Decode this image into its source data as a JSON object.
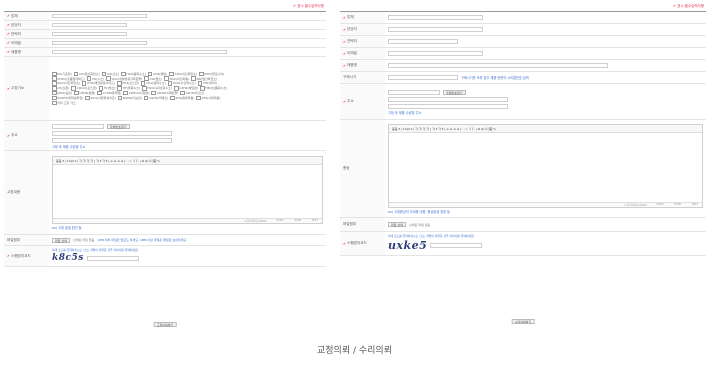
{
  "left": {
    "required_note": "✔ 표시 필수입력사항",
    "labels": {
      "company": "업체",
      "manager": "담당자",
      "phone": "연락처",
      "email": "이메일",
      "product": "제품명",
      "symptom": "고장기소",
      "address": "주소",
      "details": "고장내용",
      "attachment": "파일첨부",
      "captcha": "스팸방지코드"
    },
    "symptom_options": [
      [
        "EK(기준판)",
        "CO(일산화탄소)",
        "O2(산소)",
        "H2S(황화수소)",
        "CH4(메탄)",
        "CO2(이산화탄소)",
        "NH3(암모니아)"
      ],
      [
        "CH2O(포름알데히드)",
        "H2(수소)",
        "VOC(휘발성유기화합물)",
        "Cl2(염소)",
        "SO2(이산화황)",
        "NO(일산화질소)"
      ],
      [
        "NO2(이산화질소)",
        "ETO(에틸렌옥사이드)",
        "PH3(포스핀)",
        "HCL(염화수소)",
        "HCN(시안화수소)",
        "THT(퍼치)"
      ],
      [
        "O3(오존)",
        "COCl2(포스겐)",
        "F2(불소)",
        "HF(불화수소)",
        "H2O2(과산화수소)",
        "C2H4(에틸렌)",
        "HBr(브롬화수소)"
      ],
      [
        "SiH4(실란)",
        "C6H6(벤젠)",
        "C7H8(톨루엔)",
        "C8H10(자일렌)",
        "CH3OH(메탄올)",
        "AsH3(아르신)"
      ],
      [
        "SO2F2(불화설퍼릴)",
        "SiF4(사불화실리콘)",
        "B2H6(디보란)",
        "GeH4(저메인)",
        "SF6(육불화황)",
        "SF4(사불화황)"
      ],
      [
        "기타 고장 가스"
      ]
    ],
    "zip_button": "우편번호찾기",
    "address_note": "고정 후 제품 수령할 주소",
    "editor_toolbar": "돋움 ▾ | 12pt ▾ | 가 가 가 가 | 가 ▾ 가 ▾ | ≡ ≡ ≡ ≡ | ⁝ ⁝ | 《 》 | Ω ⊞ ☺ 🖼 ✎",
    "editor_counter": "0 입력/최대 20000",
    "editor_modes": [
      "Editor",
      "HTML",
      "TEXT"
    ],
    "details_note": "ex) 고장 발생 원인 등",
    "file_button": "파일 선택",
    "file_status": "선택된 파일 없음",
    "file_note": "1MB 이하 파일만 업로드 하세요. 1MB 이상 파일은 메일로 보내주세요.",
    "captcha_note": "아래 코드를 입력하십시오 (코드 식별이 어려운 경우 이미지를 클릭하세요)",
    "captcha_text": "k8c5s",
    "submit": "고정의뢰하기"
  },
  "right": {
    "required_note": "✔ 표시 필수입력사항",
    "labels": {
      "company": "업체",
      "manager": "담당자",
      "phone": "연락처",
      "email": "이메일",
      "product": "제품명",
      "purchase": "구매시기",
      "address": "주소",
      "symptom": "증상",
      "attachment": "파일첨부",
      "captcha": "스팸방지코드"
    },
    "purchase_note": "구매시기를 모를 경우 제품 뒷면의 시리얼번호 입력",
    "zip_button": "우편번호찾기",
    "address_note": "고정 후 제품 수령할 주소",
    "editor_toolbar": "돋움 ▾ | 12pt ▾ | 가 가 가 가 | 가 ▾ 가 ▾ | ≡ ≡ ≡ ≡ | ⁝ ⁝ | 《 》 | Ω ⊞ ☺ 🖼 ✎",
    "editor_counter": "0 입력/최대 20000",
    "editor_modes": [
      "Editor",
      "HTML",
      "TEXT"
    ],
    "symptom_note": "ex) 고장증상의 자세한 내용, 증상발생 경위 등",
    "file_button": "파일 선택",
    "file_status": "선택된 파일 없음",
    "captcha_note": "아래 코드를 입력하십시오 (코드 식별이 어려운 경우 이미지를 클릭하세요)",
    "captcha_text": "uxke5",
    "submit": "수리의뢰하기"
  },
  "caption": "교정의뢰 / 수리의뢰"
}
